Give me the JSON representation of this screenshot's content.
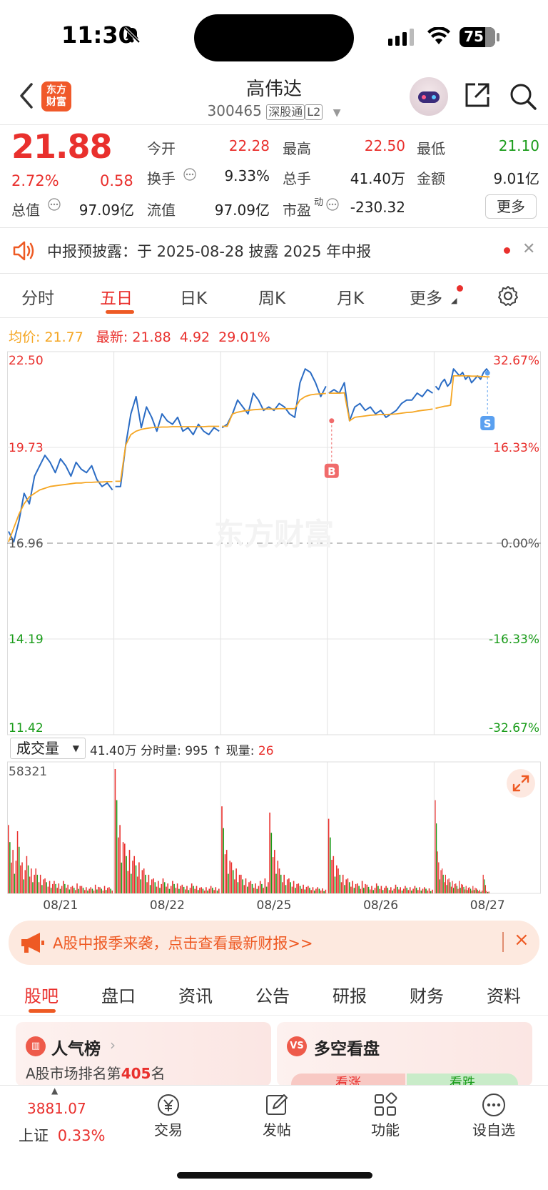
{
  "status_bar": {
    "time": "11:30",
    "battery": "75"
  },
  "header": {
    "logo_text": "东方财富",
    "stock_name": "高伟达",
    "stock_code": "300465",
    "tags": [
      "深股通",
      "L2"
    ]
  },
  "quote": {
    "price": "21.88",
    "change_pct": "2.72%",
    "change": "0.58",
    "fields": [
      {
        "label": "今开",
        "value": "22.28",
        "color": "#e9302d"
      },
      {
        "label": "最高",
        "value": "22.50",
        "color": "#e9302d"
      },
      {
        "label": "最低",
        "value": "21.10",
        "color": "#1a9c1a"
      },
      {
        "label": "换手",
        "value": "9.33%",
        "color": "#222222"
      },
      {
        "label": "总手",
        "value": "41.40万",
        "color": "#222222"
      },
      {
        "label": "金额",
        "value": "9.01亿",
        "color": "#222222"
      },
      {
        "label": "总值",
        "value": "97.09亿",
        "color": "#222222"
      },
      {
        "label": "流值",
        "value": "97.09亿",
        "color": "#222222"
      },
      {
        "label": "市盈",
        "value": "-230.32",
        "color": "#222222"
      }
    ],
    "pe_superscript": "动",
    "more_label": "更多"
  },
  "notice": {
    "text": "中报预披露：于 2025-08-28 披露 2025 年中报"
  },
  "chart_tabs": [
    "分时",
    "五日",
    "日K",
    "周K",
    "月K",
    "更多"
  ],
  "avg_line": {
    "avg_label": "均价:",
    "avg_value": "21.77",
    "latest_label": "最新:",
    "latest_value": "21.88",
    "v1": "4.92",
    "v2": "29.01%"
  },
  "chart_data": {
    "type": "line",
    "title": "",
    "y_left_ticks": [
      "22.50",
      "19.73",
      "16.96",
      "14.19",
      "11.42"
    ],
    "y_right_ticks": [
      "32.67%",
      "16.33%",
      "0.00%",
      "-16.33%",
      "-32.67%"
    ],
    "ylim": [
      11.42,
      22.5
    ],
    "prev_close": 16.96,
    "watermark": "东方财富",
    "x_labels": [
      "08/21",
      "08/22",
      "08/25",
      "08/26",
      "08/27"
    ],
    "series": [
      {
        "role": "price",
        "color": "#2b6cc4",
        "values": [
          17.3,
          17.0,
          17.6,
          18.4,
          18.1,
          18.9,
          19.2,
          19.5,
          19.3,
          19.0,
          19.4,
          19.2,
          18.9,
          19.3,
          19.1,
          19.0,
          19.2,
          18.8,
          18.6,
          18.7,
          18.5,
          18.6,
          18.6,
          19.8,
          20.7,
          21.2,
          20.3,
          20.9,
          20.6,
          20.2,
          20.7,
          20.5,
          20.4,
          20.6,
          20.2,
          20.3,
          20.1,
          20.4,
          20.2,
          20.1,
          20.3,
          20.2,
          20.3,
          20.4,
          20.7,
          21.1,
          20.9,
          20.7,
          21.3,
          21.1,
          20.8,
          20.9,
          20.8,
          21.0,
          20.9,
          20.7,
          20.6,
          21.6,
          22.0,
          21.9,
          21.6,
          21.2,
          21.5,
          21.3,
          21.4,
          21.3,
          21.6,
          20.5,
          20.9,
          21.0,
          20.8,
          20.9,
          20.7,
          20.8,
          20.6,
          20.7,
          20.8,
          21.0,
          21.1,
          21.1,
          21.3,
          21.2,
          21.4,
          21.3,
          21.5,
          21.4,
          21.6,
          21.7,
          21.5,
          21.6,
          22.0,
          21.9,
          21.8,
          21.9,
          21.7,
          21.8,
          21.6,
          21.7,
          21.8,
          21.7,
          21.9,
          22.0,
          21.88
        ]
      },
      {
        "role": "avg",
        "color": "#f5a623",
        "values": [
          17.0,
          17.4,
          17.8,
          18.1,
          18.3,
          18.4,
          18.5,
          18.55,
          18.6,
          18.62,
          18.64,
          18.66,
          18.68,
          18.7,
          18.7,
          18.72,
          18.72,
          18.73,
          18.73,
          18.74,
          18.74,
          18.75,
          18.75,
          19.8,
          20.1,
          20.2,
          20.25,
          20.28,
          20.3,
          20.31,
          20.32,
          20.32,
          20.33,
          20.33,
          20.33,
          20.33,
          20.33,
          20.33,
          20.33,
          20.34,
          20.34,
          20.34,
          20.34,
          20.34,
          20.7,
          20.75,
          20.78,
          20.8,
          20.82,
          20.83,
          20.84,
          20.84,
          20.84,
          20.85,
          20.85,
          20.85,
          20.85,
          21.1,
          21.2,
          21.25,
          21.27,
          21.28,
          21.29,
          21.3,
          21.3,
          21.3,
          21.31,
          20.5,
          20.6,
          20.62,
          20.64,
          20.66,
          20.67,
          20.68,
          20.68,
          20.69,
          20.7,
          20.72,
          20.74,
          20.75,
          20.78,
          20.8,
          20.82,
          20.84,
          20.86,
          20.88,
          20.9,
          20.92,
          20.93,
          20.95,
          21.8,
          21.8,
          21.8,
          21.8,
          21.8,
          21.8,
          21.79,
          21.79,
          21.79,
          21.78,
          21.78,
          21.77,
          21.77
        ]
      }
    ],
    "markers": [
      {
        "label": "B",
        "day": "08/26",
        "price": 20.5,
        "color": "#f06b6b"
      },
      {
        "label": "S",
        "day": "08/27",
        "price": 21.88,
        "color": "#5aa0f0"
      }
    ]
  },
  "volume": {
    "selector_label": "成交量",
    "info_total": "41.40万",
    "info_minute_label": "分时量:",
    "info_minute_value": "995",
    "info_now_label": "现量:",
    "info_now_value": "26",
    "max_label": "58321",
    "peaks": [
      [
        0.55,
        0.35,
        0.5,
        0.25,
        0.3,
        0.2,
        0.2,
        0.15,
        0.12,
        0.1,
        0.1,
        0.08,
        0.1,
        0.07,
        0.06,
        0.08,
        0.06,
        0.05,
        0.05,
        0.07,
        0.05,
        0.06,
        0.05
      ],
      [
        1.0,
        0.55,
        0.4,
        0.35,
        0.3,
        0.25,
        0.2,
        0.15,
        0.12,
        0.1,
        0.12,
        0.08,
        0.1,
        0.08,
        0.07,
        0.06,
        0.08,
        0.06,
        0.05,
        0.05,
        0.06,
        0.05
      ],
      [
        0.7,
        0.35,
        0.25,
        0.2,
        0.15,
        0.12,
        0.1,
        0.08,
        0.1,
        0.12,
        0.65,
        0.35,
        0.2,
        0.15,
        0.12,
        0.1,
        0.08,
        0.07,
        0.06,
        0.05,
        0.05,
        0.04
      ],
      [
        0.6,
        0.3,
        0.2,
        0.15,
        0.12,
        0.1,
        0.08,
        0.1,
        0.07,
        0.06,
        0.08,
        0.06,
        0.06,
        0.05,
        0.07,
        0.05,
        0.06,
        0.05,
        0.06,
        0.05,
        0.05,
        0.04
      ],
      [
        0.75,
        0.25,
        0.2,
        0.15,
        0.12,
        0.1,
        0.08,
        0.1,
        0.07,
        0.06,
        0.05,
        0.06,
        0.04,
        0.03,
        0.15,
        0.02
      ]
    ]
  },
  "banner": {
    "text": "A股中报季来袭，点击查看最新财报>>"
  },
  "bottom_tabs": [
    "股吧",
    "盘口",
    "资讯",
    "公告",
    "研报",
    "财务",
    "资料"
  ],
  "cards": {
    "left_title": "人气榜",
    "left_sub_prefix": "A股市场排名第",
    "left_rank": "405",
    "left_sub_suffix": "名",
    "right_icon": "VS",
    "right_title": "多空看盘",
    "right_bull": "看涨",
    "right_bear": "看跌"
  },
  "bottom_nav": {
    "index_value": "3881.07",
    "index_name": "上证",
    "index_pct": "0.33%",
    "items": [
      "交易",
      "发帖",
      "功能",
      "设自选"
    ]
  }
}
